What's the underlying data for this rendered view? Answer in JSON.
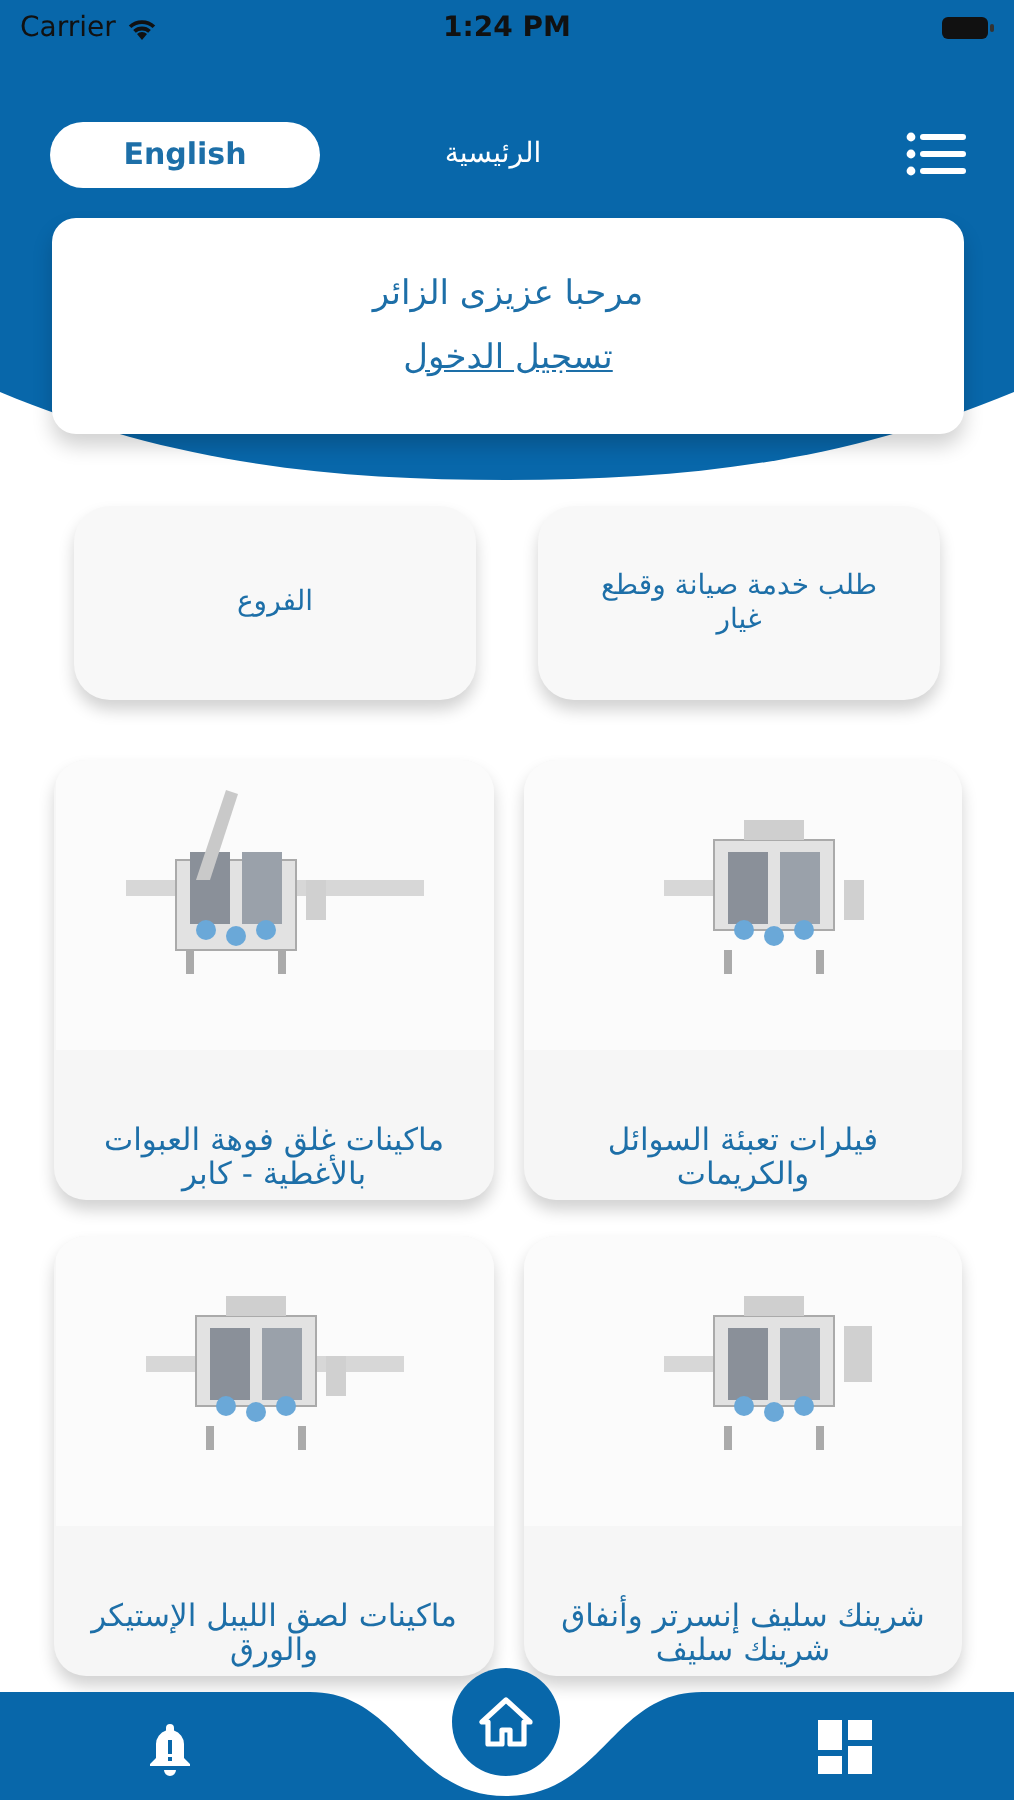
{
  "status_bar": {
    "carrier": "Carrier",
    "time": "1:24 PM"
  },
  "header": {
    "language_button": "English",
    "title": "الرئيسية"
  },
  "welcome": {
    "greeting": "مرحبا عزيزى الزائر",
    "login_link": "تسجيل الدخول"
  },
  "shortcuts": [
    {
      "label": "طلب خدمة صيانة وقطع غيار"
    },
    {
      "label": "الفروع"
    }
  ],
  "products": [
    {
      "title": "فيلرات تعبئة السوائل والكريمات",
      "kind": "picture"
    },
    {
      "title": "ماكينات غلق فوهة العبوات بالأغطية - كابر",
      "kind": "picture"
    },
    {
      "title": "شرينك سليف إنسرتر وأنفاق شرينك سليف",
      "kind": "picture"
    },
    {
      "title": "ماكينات لصق الليبل الإستيكر والورق",
      "kind": "picture"
    }
  ]
}
